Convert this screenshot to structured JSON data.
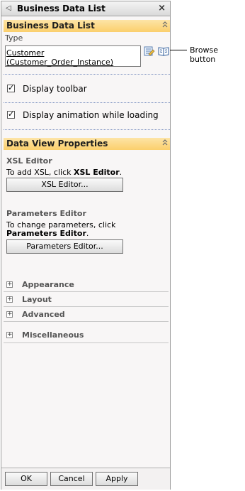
{
  "panel": {
    "title": "Business Data List",
    "collapse_glyph": "◁",
    "close_glyph": "×"
  },
  "section1": {
    "title": "Business Data List",
    "toggle_glyph": "⌃",
    "type_label": "Type",
    "type_value_line1": "Customer",
    "type_value_line2": "(Customer_Order_Instance)",
    "icons": [
      "edit-list-icon",
      "browse-book-icon"
    ],
    "display_toolbar": {
      "label": "Display toolbar",
      "checked": true
    },
    "display_animation": {
      "label": "Display animation while loading",
      "checked": true
    }
  },
  "section2": {
    "title": "Data View Properties",
    "toggle_glyph": "⌃",
    "xsl": {
      "heading": "XSL Editor",
      "text_plain": "To add XSL, click ",
      "text_bold": "XSL Editor",
      "text_end": ".",
      "button": "XSL Editor..."
    },
    "params": {
      "heading": "Parameters Editor",
      "text_plain": "To change parameters, click",
      "text_bold": "Parameters Editor",
      "text_end": ".",
      "button": "Parameters Editor..."
    },
    "expanders": [
      "Appearance",
      "Layout",
      "Advanced",
      "Miscellaneous"
    ]
  },
  "footer": {
    "ok": "OK",
    "cancel": "Cancel",
    "apply": "Apply"
  },
  "callout": {
    "text": "Browse button"
  },
  "colors": {
    "section_header_top": "#fde4a6",
    "section_header_bottom": "#fbcf6c",
    "panel_bg": "#f8f6f6",
    "divider": "#7a8fbf"
  }
}
